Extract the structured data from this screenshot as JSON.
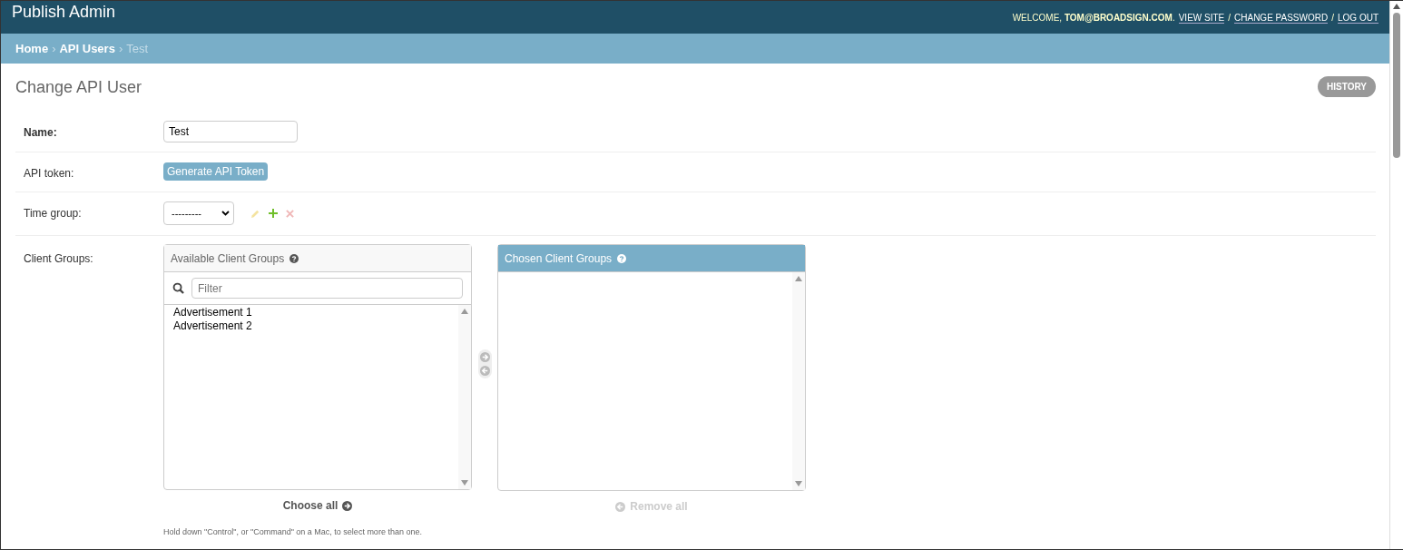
{
  "header": {
    "title": "Publish Admin",
    "welcome": "WELCOME, **TOM@BROADSIGN.COM**.",
    "links": [
      "VIEW SITE",
      "CHANGE PASSWORD",
      "LOG OUT"
    ],
    "separator": "/"
  },
  "breadcrumbs": [
    {
      "label": "Home",
      "current": false
    },
    {
      "label": "API Users",
      "current": false
    },
    {
      "label": "Test",
      "current": true
    }
  ],
  "breadcrumb_separator": "›",
  "page": {
    "title": "Change API User",
    "history_button": "HISTORY"
  },
  "fields": [
    {
      "kind": "text",
      "label": "Name:",
      "required": true,
      "value": "Test"
    },
    {
      "kind": "button",
      "label": "API token:",
      "required": false,
      "button": "Generate API Token"
    },
    {
      "kind": "select",
      "label": "Time group:",
      "required": false,
      "value": "---------",
      "actions": [
        {
          "kind": "edit",
          "disabled": true
        },
        {
          "kind": "add",
          "disabled": false
        },
        {
          "kind": "delete",
          "disabled": true
        }
      ]
    },
    {
      "kind": "selector",
      "label": "Client Groups:",
      "required": false,
      "available": {
        "title": "Available Client Groups",
        "filter_placeholder": "Filter",
        "options": [
          "Advertisement 1",
          "Advertisement 2"
        ],
        "action": "Choose all",
        "disabled": false
      },
      "chosen": {
        "title": "Chosen Client Groups",
        "action": "Remove all",
        "disabled": true
      },
      "add_disabled": true,
      "remove_disabled": true,
      "help": "Hold down \"Control\", or \"Command\" on a Mac, to select more than one."
    }
  ]
}
